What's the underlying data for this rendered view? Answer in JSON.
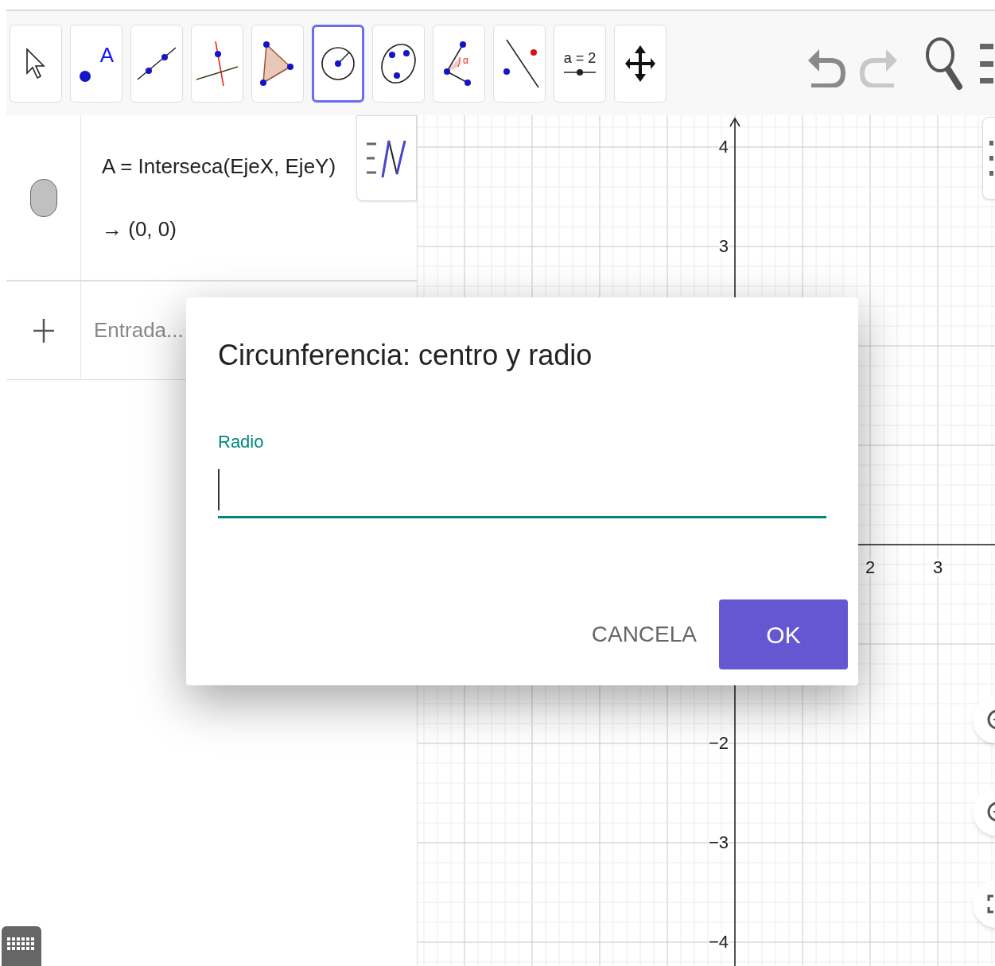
{
  "toolbar": {
    "tools": [
      {
        "kind": "move",
        "selected": false
      },
      {
        "kind": "point",
        "label": "A",
        "selected": false
      },
      {
        "kind": "line",
        "selected": false
      },
      {
        "kind": "perpendicular",
        "selected": false
      },
      {
        "kind": "polygon",
        "selected": false
      },
      {
        "kind": "circle-radius",
        "selected": true
      },
      {
        "kind": "conic",
        "selected": false
      },
      {
        "kind": "angle",
        "label": "α",
        "selected": false
      },
      {
        "kind": "reflect",
        "selected": false
      },
      {
        "kind": "slider",
        "label": "a = 2",
        "selected": false
      },
      {
        "kind": "move-view",
        "selected": false
      }
    ],
    "undo_enabled": true,
    "redo_enabled": false
  },
  "algebra": {
    "items": [
      {
        "definition": "A = Interseca(EjeX, EjeY)",
        "value": "→ (0, 0)",
        "visible": true
      }
    ],
    "input": {
      "placeholder": "Entrada..."
    }
  },
  "graphics": {
    "x_labels": [
      "2",
      "3"
    ],
    "y_labels": [
      "4",
      "3",
      "−2",
      "−3",
      "−4"
    ]
  },
  "dialog": {
    "title": "Circunferencia: centro y radio",
    "field": {
      "label": "Radio",
      "focused": true
    },
    "buttons": [
      {
        "label": "CANCELA",
        "kind": "text"
      },
      {
        "label": "OK",
        "kind": "primary"
      }
    ]
  }
}
